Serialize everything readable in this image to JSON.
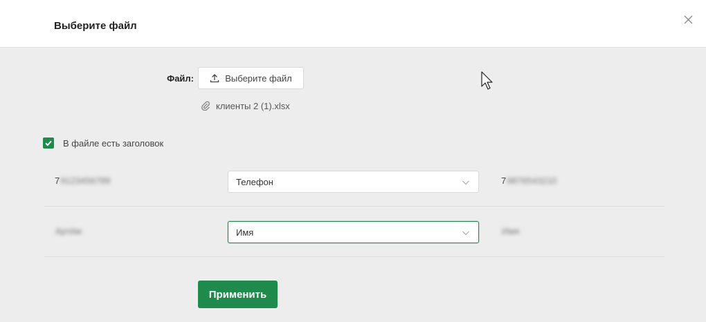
{
  "dialog": {
    "title": "Выберите файл"
  },
  "file_field": {
    "label": "Файл:",
    "upload_button_label": "Выберите файл",
    "upload_icon": "upload-icon",
    "attached_file_name": "клиенты 2 (1).xlsx",
    "attached_icon": "paperclip-icon"
  },
  "has_header_checkbox": {
    "label": "В файле есть заголовок",
    "checked": true
  },
  "mapping_rows": [
    {
      "left_prefix": "7",
      "left_blurred": "9123456789",
      "selected_field": "Телефон",
      "right_prefix": "7",
      "right_blurred": "9876543210"
    },
    {
      "left_prefix": "",
      "left_blurred": "Артём",
      "selected_field": "Имя",
      "right_prefix": "",
      "right_blurred": "Имя"
    }
  ],
  "apply_button": {
    "label": "Применить"
  },
  "colors": {
    "accent": "#1e8a4c",
    "header_bg": "#ffffff",
    "body_bg": "#ededed"
  }
}
